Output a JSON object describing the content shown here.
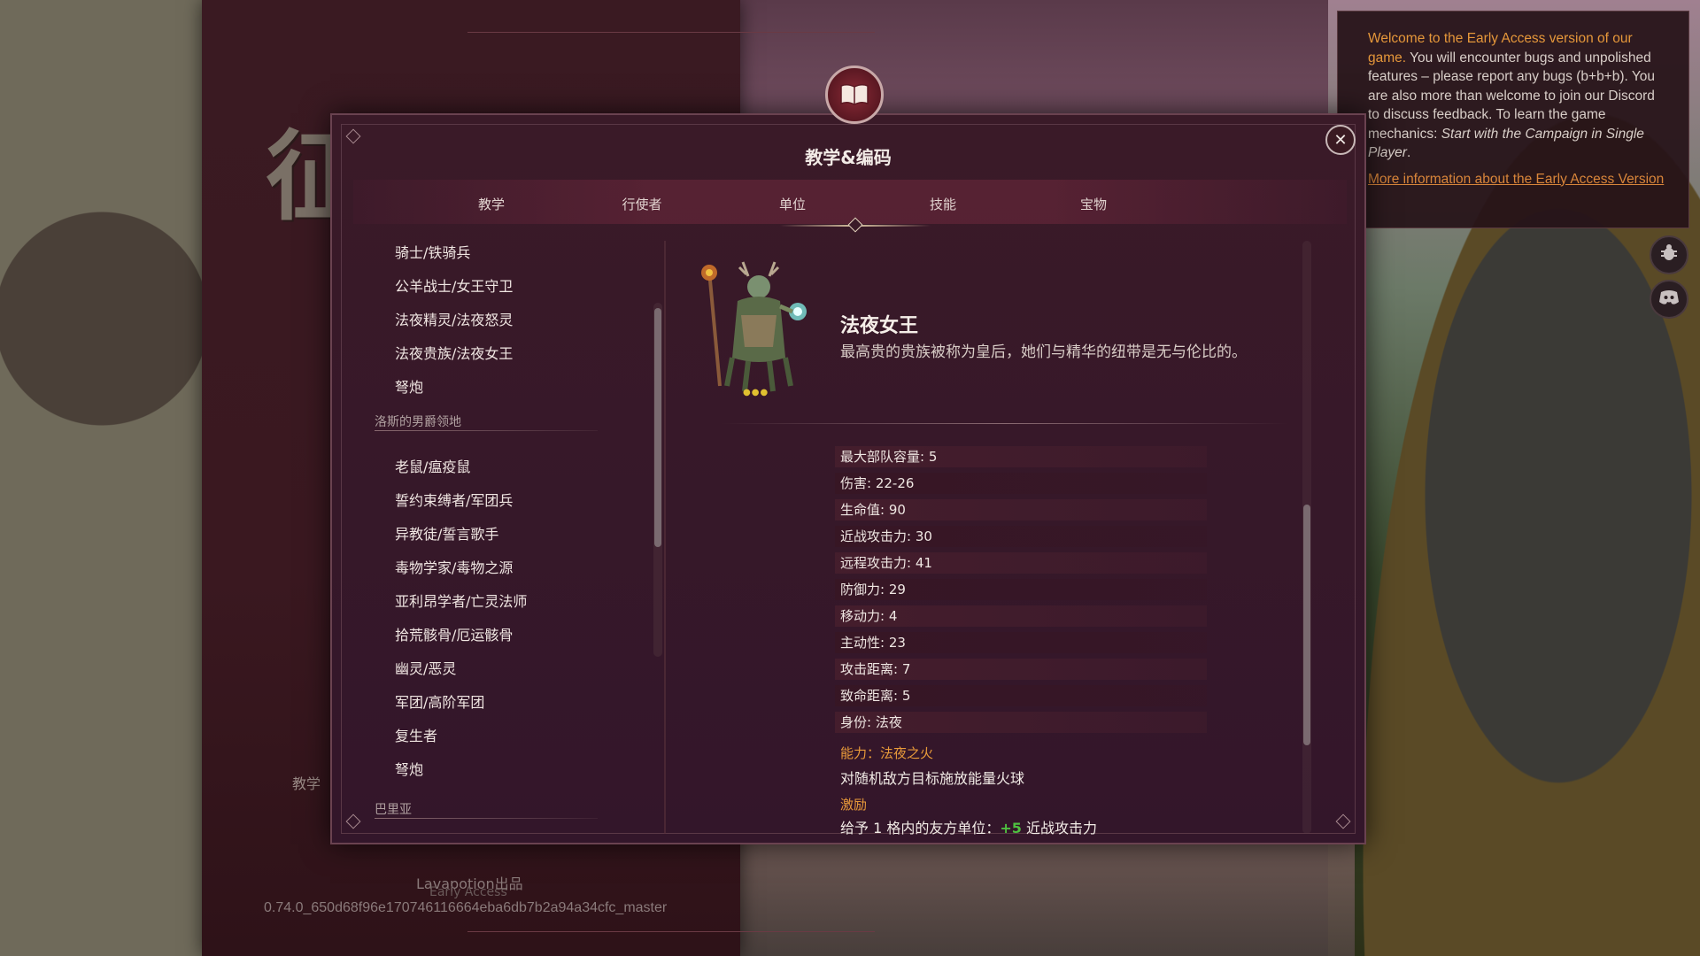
{
  "background_menu": {
    "logo_text": "征",
    "tutorial_label": "教学",
    "credit": "Lavapotion出品",
    "early_access": "Early Access",
    "version": "0.74.0_650d68f96e170746116664eba6db7b2a94a34cfc_master"
  },
  "notice": {
    "lead_highlight": "Welcome to the Early Access version of our game.",
    "body": " You will encounter bugs and unpolished features – please report any bugs (b+b+b). You are also more than welcome to join our Discord to discuss feedback. To learn the game mechanics: ",
    "italic": "Start with the Campaign in Single Player",
    "end": ".",
    "link": "More information about the Early Access Version"
  },
  "side_buttons": {
    "bug_icon": "bug-icon",
    "discord_icon": "discord-icon"
  },
  "modal": {
    "title": "教学&编码",
    "close_label": "✕",
    "tabs": [
      {
        "label": "教学"
      },
      {
        "label": "行使者"
      },
      {
        "label": "单位",
        "active": true
      },
      {
        "label": "技能"
      },
      {
        "label": "宝物"
      }
    ]
  },
  "unit_list": {
    "group1_items": [
      "骑士/铁骑兵",
      "公羊战士/女王守卫",
      "法夜精灵/法夜怒灵",
      "法夜贵族/法夜女王",
      "弩炮"
    ],
    "group2_title": "洛斯的男爵领地",
    "group2_items": [
      "老鼠/瘟疫鼠",
      "誓约束缚者/军团兵",
      "异教徒/誓言歌手",
      "毒物学家/毒物之源",
      "亚利昂学者/亡灵法师",
      "拾荒骸骨/厄运骸骨",
      "幽灵/恶灵",
      "军团/高阶军团",
      "复生者",
      "弩炮"
    ],
    "group3_title": "巴里亚"
  },
  "unit_detail": {
    "name": "法夜女王",
    "description": "最高贵的贵族被称为皇后，她们与精华的纽带是无与伦比的。",
    "stars": "●●●",
    "stats": [
      "最大部队容量: 5",
      "伤害: 22-26",
      "生命值: 90",
      "近战攻击力: 30",
      "远程攻击力: 41",
      "防御力: 29",
      "移动力: 4",
      "主动性: 23",
      "攻击距离: 7",
      "致命距离: 5",
      "身份: 法夜"
    ],
    "ability_title": "能力：法夜之火",
    "ability_desc": "对随机敌方目标施放能量火球",
    "inspire_title": "激励",
    "inspire_prefix": "给予 1 格内的友方单位：",
    "inspire_bonus": "+5",
    "inspire_suffix": " 近战攻击力"
  },
  "colors": {
    "accent_orange": "#e89a3a",
    "bonus_green": "#4ec040",
    "modal_bg": "#3a1a28"
  }
}
